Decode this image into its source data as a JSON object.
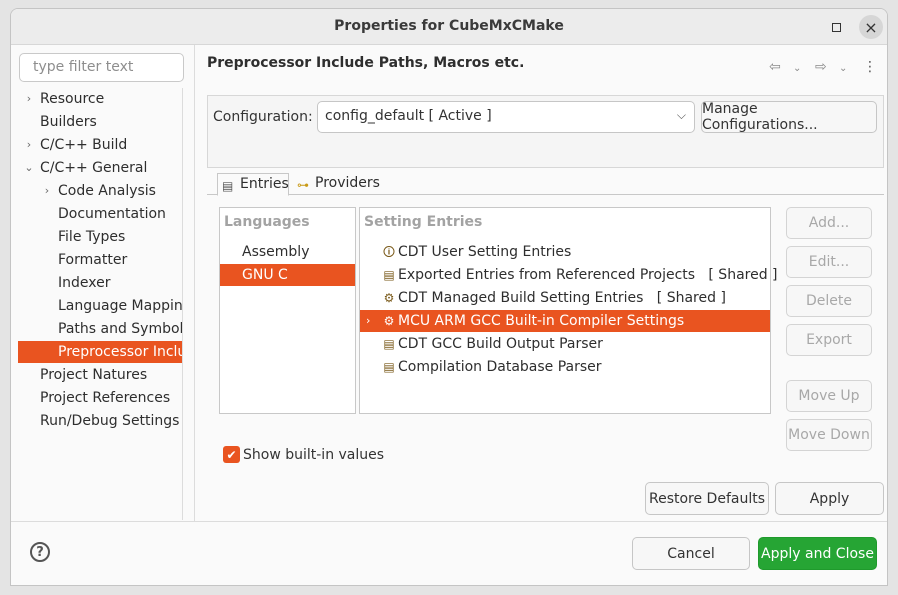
{
  "window": {
    "title": "Properties for CubeMxCMake"
  },
  "filter": {
    "placeholder": "type filter text"
  },
  "tree": [
    {
      "label": "Resource",
      "indent": 0,
      "expander": "›"
    },
    {
      "label": "Builders",
      "indent": 0,
      "expander": ""
    },
    {
      "label": "C/C++ Build",
      "indent": 0,
      "expander": "›"
    },
    {
      "label": "C/C++ General",
      "indent": 0,
      "expander": "⌄"
    },
    {
      "label": "Code Analysis",
      "indent": 1,
      "expander": "›"
    },
    {
      "label": "Documentation",
      "indent": 1,
      "expander": ""
    },
    {
      "label": "File Types",
      "indent": 1,
      "expander": ""
    },
    {
      "label": "Formatter",
      "indent": 1,
      "expander": ""
    },
    {
      "label": "Indexer",
      "indent": 1,
      "expander": ""
    },
    {
      "label": "Language Mapping",
      "indent": 1,
      "expander": ""
    },
    {
      "label": "Paths and Symbols",
      "indent": 1,
      "expander": ""
    },
    {
      "label": "Preprocessor Inclu",
      "indent": 1,
      "expander": "",
      "selected": true
    },
    {
      "label": "Project Natures",
      "indent": 0,
      "expander": ""
    },
    {
      "label": "Project References",
      "indent": 0,
      "expander": ""
    },
    {
      "label": "Run/Debug Settings",
      "indent": 0,
      "expander": ""
    }
  ],
  "page": {
    "title": "Preprocessor Include Paths, Macros etc.",
    "config_label": "Configuration:",
    "config_value": "config_default  [ Active ]",
    "manage_label": "Manage Configurations..."
  },
  "tabs": [
    {
      "label": "Entries",
      "icon": "entries-icon"
    },
    {
      "label": "Providers",
      "icon": "providers-icon"
    }
  ],
  "languages": {
    "header": "Languages",
    "items": [
      {
        "label": "Assembly"
      },
      {
        "label": "GNU C",
        "selected": true
      }
    ]
  },
  "entries": {
    "header": "Setting Entries",
    "items": [
      {
        "label": "CDT User Setting Entries",
        "icon": "user-setting-icon",
        "glyph": "🛈"
      },
      {
        "label": "Exported Entries from Referenced Projects   [ Shared ]",
        "icon": "exported-entries-icon",
        "glyph": "▤"
      },
      {
        "label": "CDT Managed Build Setting Entries   [ Shared ]",
        "icon": "managed-build-icon",
        "glyph": "⚙"
      },
      {
        "label": "MCU ARM GCC Built-in Compiler Settings",
        "icon": "compiler-settings-icon",
        "glyph": "⚙",
        "selected": true,
        "expandable": true
      },
      {
        "label": "CDT GCC Build Output Parser",
        "icon": "output-parser-icon",
        "glyph": "▤"
      },
      {
        "label": "Compilation Database Parser",
        "icon": "database-parser-icon",
        "glyph": "▤"
      }
    ]
  },
  "side_buttons": {
    "add": "Add...",
    "edit": "Edit...",
    "delete": "Delete",
    "export": "Export",
    "move_up": "Move Up",
    "move_down": "Move Down"
  },
  "show_builtin": {
    "label": "Show built-in values",
    "checked": true
  },
  "buttons": {
    "restore": "Restore Defaults",
    "apply": "Apply",
    "cancel": "Cancel",
    "apply_close": "Apply and Close"
  },
  "colors": {
    "accent": "#e95420",
    "primary": "#26a534"
  }
}
